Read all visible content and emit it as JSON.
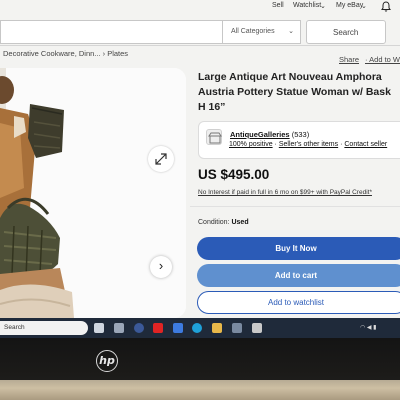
{
  "topbar": {
    "sell": "Sell",
    "watchlist": "Watchlist",
    "watchlist_chev": "⌄",
    "myebay": "My eBay",
    "myebay_chev": "⌄"
  },
  "search": {
    "category": "All Categories",
    "category_chev": "⌄",
    "button": "Search"
  },
  "breadcrumb": "Decorative Cookware, Dinn...  ›  Plates",
  "actions": {
    "share": "Share",
    "add_to_watchlist": "· Add to Wa"
  },
  "listing": {
    "title": "Large Antique Art Nouveau Amphora\nAustria Pottery Statue Woman w/ Bask\nH 16”",
    "price": "US $495.00",
    "financing": "No Interest if paid in full in 6 mo on $99+ with PayPal Credit*",
    "condition_label": "Condition:",
    "condition_value": "Used"
  },
  "seller": {
    "name": "AntiqueGalleries",
    "feedback_count": "(533)",
    "positive": "100% positive",
    "other_items": "Seller's other items",
    "contact": "Contact seller"
  },
  "buttons": {
    "buy": "Buy It Now",
    "cart": "Add to cart",
    "watch": "Add to watchlist"
  },
  "gallery": {
    "next_glyph": "›"
  },
  "taskbar": {
    "search": "Search"
  },
  "colors": {
    "buy_blue": "#2b5bb7",
    "cart_blue": "#5f90cf",
    "taskbar": "#1f2a3a"
  }
}
